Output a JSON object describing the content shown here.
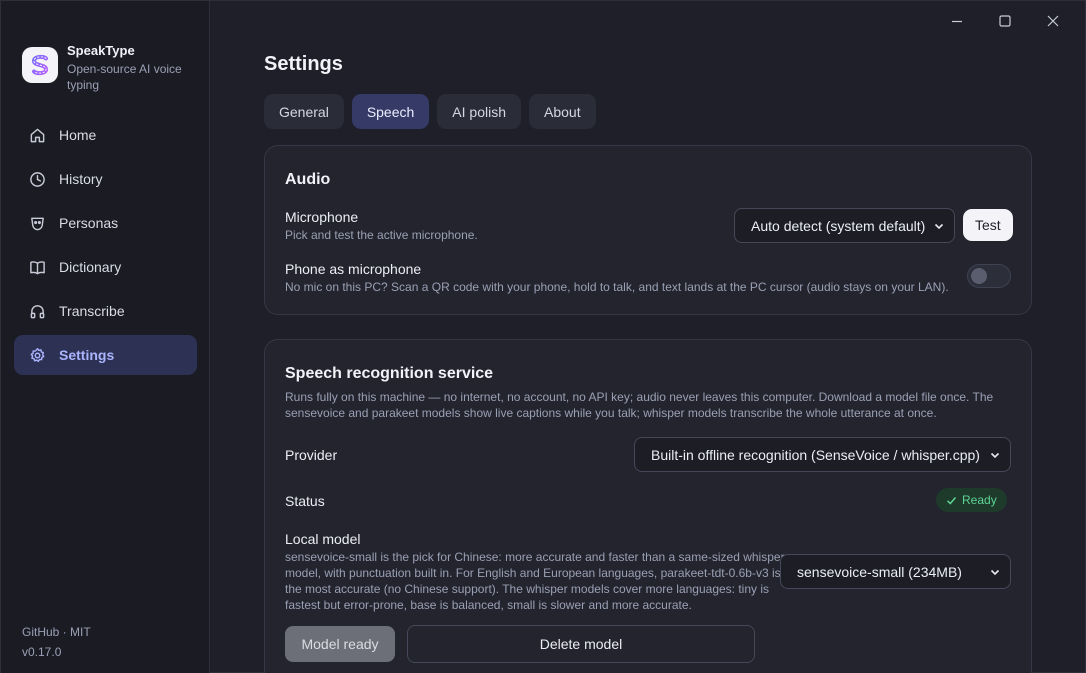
{
  "app": {
    "name": "SpeakType",
    "tagline": "Open-source AI voice typing"
  },
  "sidebar": {
    "items": [
      {
        "label": "Home",
        "icon": "home-icon"
      },
      {
        "label": "History",
        "icon": "clock-icon"
      },
      {
        "label": "Personas",
        "icon": "persona-icon"
      },
      {
        "label": "Dictionary",
        "icon": "book-icon"
      },
      {
        "label": "Transcribe",
        "icon": "headphones-icon"
      },
      {
        "label": "Settings",
        "icon": "gear-icon",
        "active": true
      }
    ],
    "footer_links": "GitHub · MIT",
    "version": "v0.17.0"
  },
  "page": {
    "title": "Settings"
  },
  "tabs": [
    {
      "label": "General"
    },
    {
      "label": "Speech",
      "active": true
    },
    {
      "label": "AI polish"
    },
    {
      "label": "About"
    }
  ],
  "audio": {
    "title": "Audio",
    "microphone": {
      "label": "Microphone",
      "desc": "Pick and test the active microphone.",
      "selected": "Auto detect (system default)",
      "test_label": "Test"
    },
    "phone_mic": {
      "label": "Phone as microphone",
      "desc": "No mic on this PC? Scan a QR code with your phone, hold to talk, and text lands at the PC cursor (audio stays on your LAN).",
      "enabled": false
    }
  },
  "speech": {
    "title": "Speech recognition service",
    "desc": "Runs fully on this machine — no internet, no account, no API key; audio never leaves this computer. Download a model file once. The sensevoice and parakeet models show live captions while you talk; whisper models transcribe the whole utterance at once.",
    "provider": {
      "label": "Provider",
      "selected": "Built-in offline recognition (SenseVoice / whisper.cpp)"
    },
    "status": {
      "label": "Status",
      "value": "Ready"
    },
    "local_model": {
      "label": "Local model",
      "desc": "sensevoice-small is the pick for Chinese: more accurate and faster than a same-sized whisper model, with punctuation built in. For English and European languages, parakeet-tdt-0.6b-v3 is the most accurate (no Chinese support). The whisper models cover more languages: tiny is fastest but error-prone, base is balanced, small is slower and more accurate.",
      "selected": "sensevoice-small (234MB)",
      "ready_label": "Model ready",
      "delete_label": "Delete model"
    }
  },
  "colors": {
    "accent": "#aab4ff",
    "active_bg": "#2d3153",
    "ready": "#5fd494"
  }
}
